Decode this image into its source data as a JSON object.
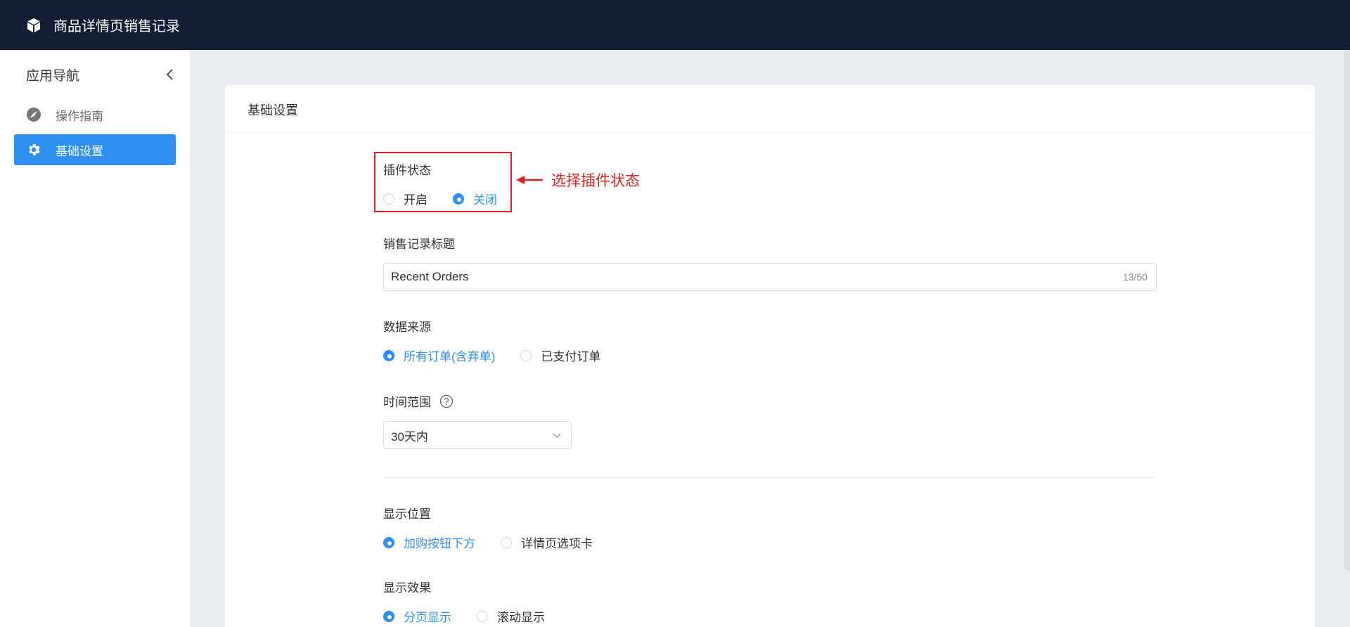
{
  "header": {
    "title": "商品详情页销售记录",
    "logo_icon": "box-icon"
  },
  "sidebar": {
    "title": "应用导航",
    "items": [
      {
        "label": "操作指南",
        "icon": "compass-icon",
        "active": false
      },
      {
        "label": "基础设置",
        "icon": "gear-icon",
        "active": true
      }
    ]
  },
  "card": {
    "title": "基础设置",
    "plugin_status": {
      "label": "插件状态",
      "options": [
        "开启",
        "关闭"
      ],
      "selected": "关闭"
    },
    "annotation": {
      "text": "选择插件状态"
    },
    "sales_title": {
      "label": "销售记录标题",
      "value": "Recent Orders",
      "count": "13/50"
    },
    "data_source": {
      "label": "数据来源",
      "options": [
        "所有订单(含弃单)",
        "已支付订单"
      ],
      "selected": "所有订单(含弃单)"
    },
    "time_range": {
      "label": "时间范围",
      "value": "30天内"
    },
    "display_position": {
      "label": "显示位置",
      "options": [
        "加购按钮下方",
        "详情页选项卡"
      ],
      "selected": "加购按钮下方"
    },
    "display_effect": {
      "label": "显示效果",
      "options": [
        "分页显示",
        "滚动显示"
      ],
      "selected": "分页显示"
    }
  },
  "colors": {
    "header_bg": "#141d33",
    "accent": "#2d8ff0",
    "annotation": "#e02020",
    "page_bg": "#e9edf2"
  }
}
